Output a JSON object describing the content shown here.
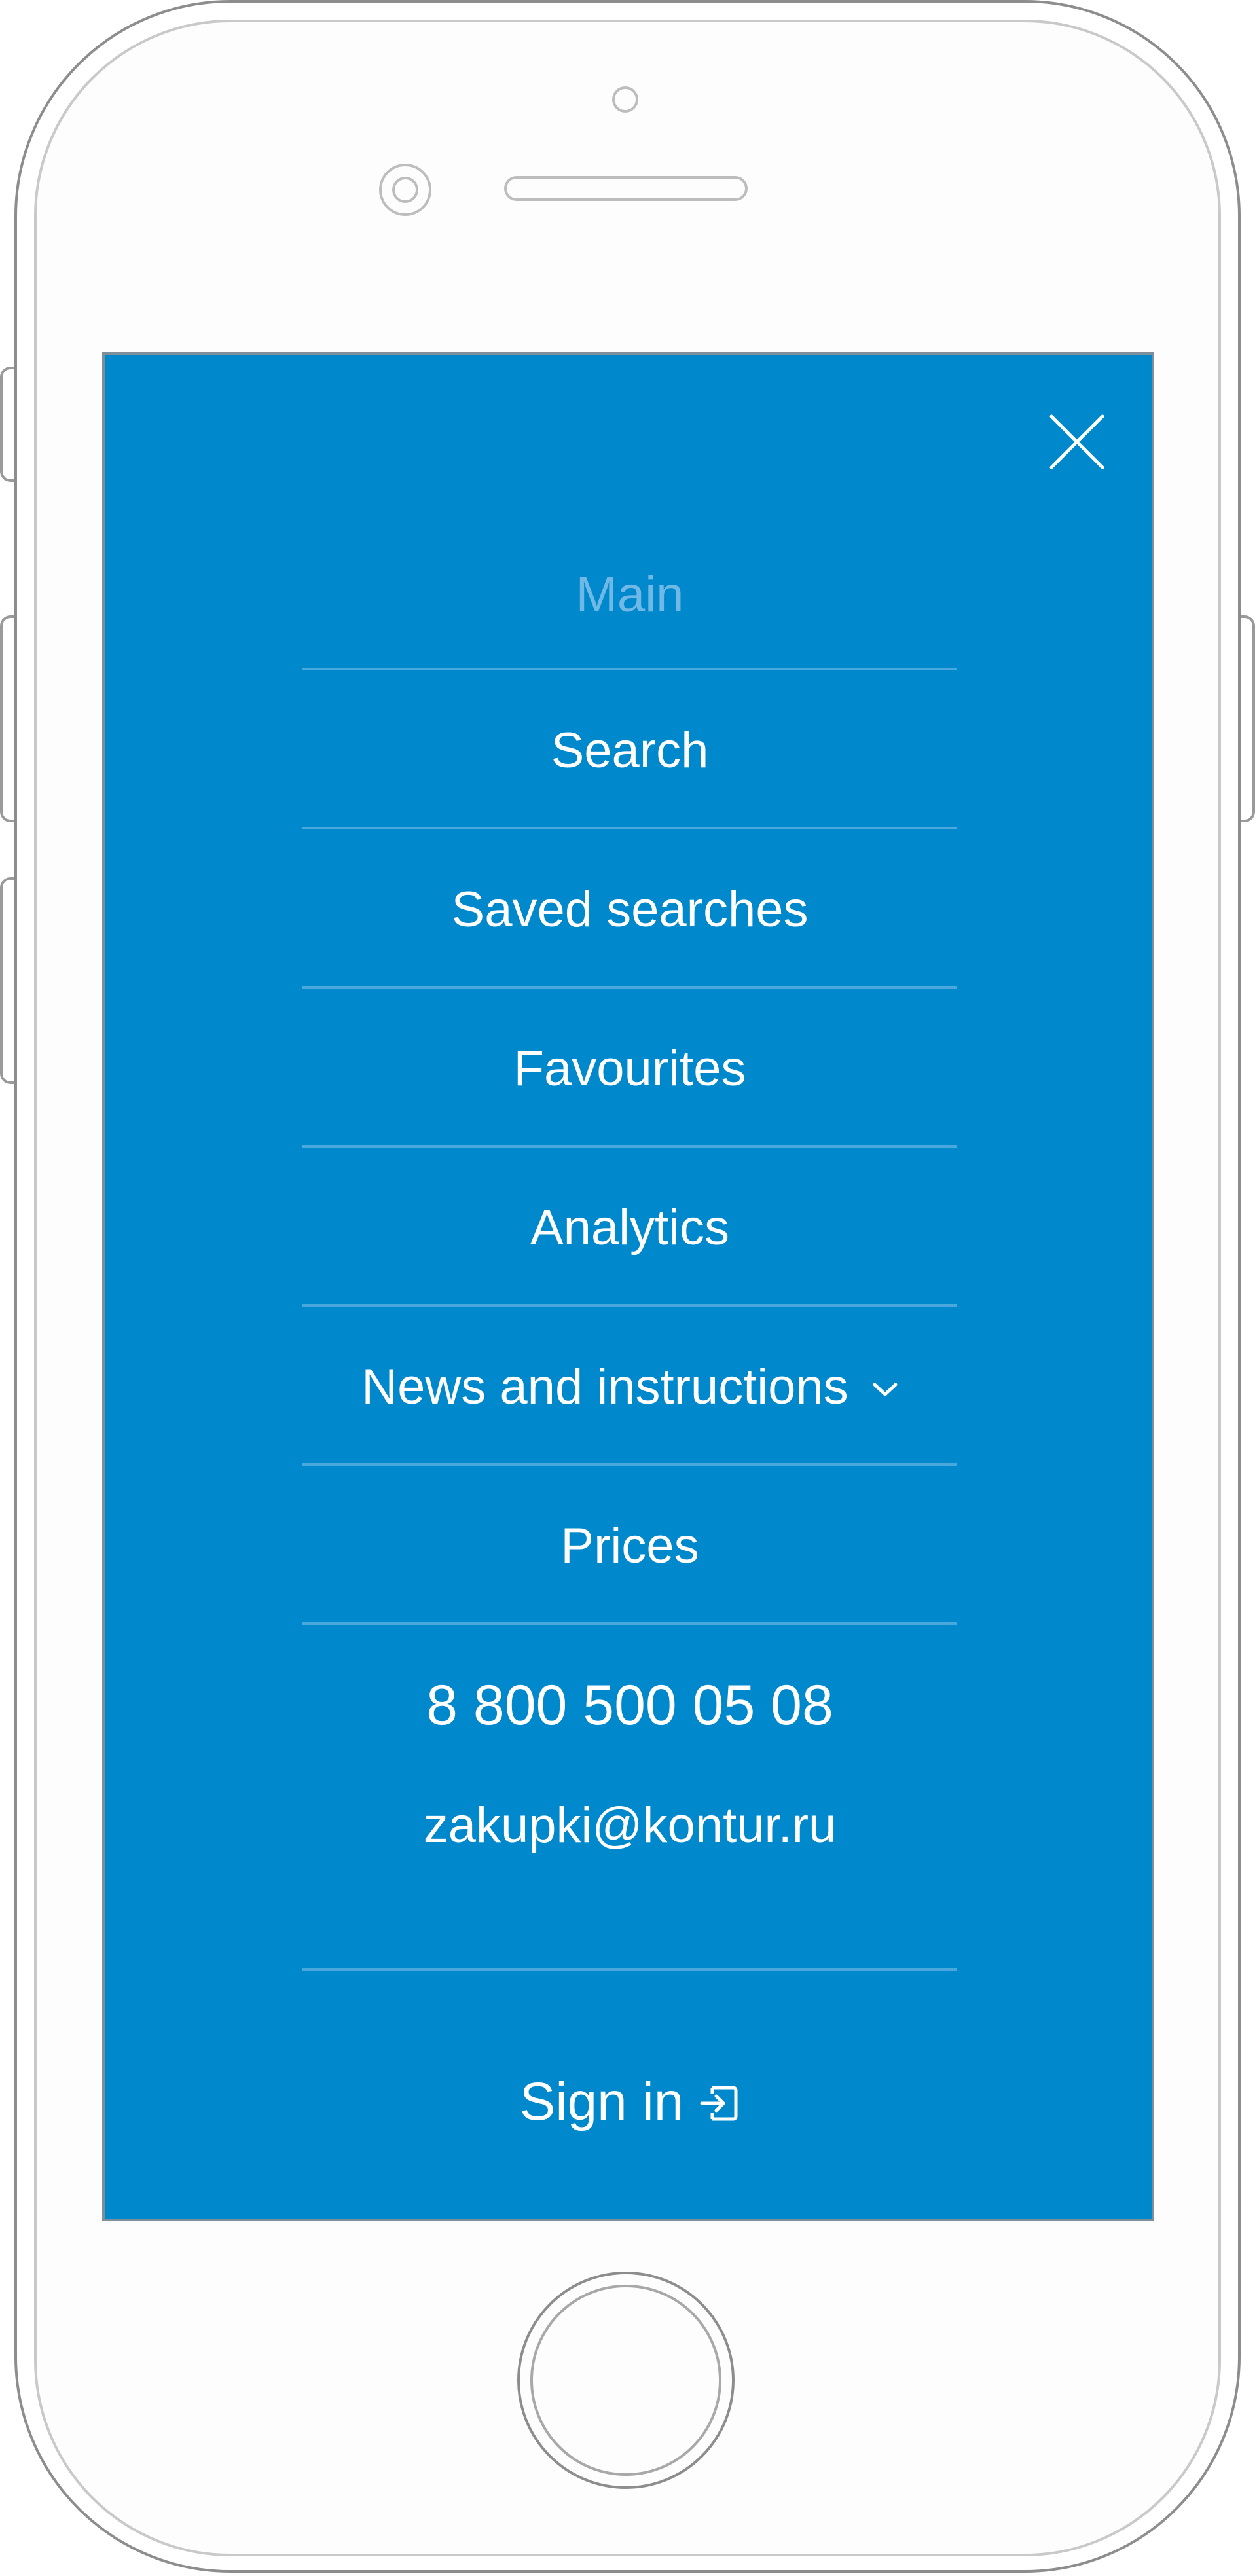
{
  "menu": {
    "items": [
      {
        "label": "Main",
        "active": true
      },
      {
        "label": "Search"
      },
      {
        "label": "Saved searches"
      },
      {
        "label": "Favourites"
      },
      {
        "label": "Analytics"
      },
      {
        "label": "News and instructions",
        "has_dropdown": true
      },
      {
        "label": "Prices"
      }
    ]
  },
  "contacts": {
    "phone": "8 800 500 05 08",
    "email": "zakupki@kontur.ru"
  },
  "auth": {
    "sign_in_label": "Sign in"
  },
  "icons": {
    "close": "close-icon",
    "dropdown": "chevron-down-icon",
    "sign_in": "sign-in-icon"
  },
  "colors": {
    "menu_background": "#0088cc",
    "text": "#ffffff",
    "active_text": "#70b9e6",
    "divider": "#4aa8dc"
  }
}
